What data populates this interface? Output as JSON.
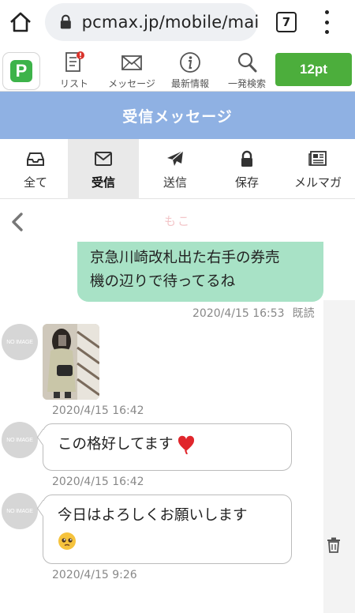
{
  "browser": {
    "url": "pcmax.jp/mobile/mail_",
    "tab_count": "7"
  },
  "site_nav": {
    "logo_letter": "P",
    "items": [
      {
        "label": "リスト",
        "icon": "list-icon"
      },
      {
        "label": "メッセージ",
        "icon": "envelope-icon"
      },
      {
        "label": "最新情報",
        "icon": "info-icon"
      },
      {
        "label": "一発検索",
        "icon": "search-icon"
      }
    ],
    "points": "12pt",
    "colors": {
      "points_button": "#4cae3c",
      "notification_badge": "#d9332b"
    }
  },
  "title_bar": {
    "title": "受信メッセージ",
    "color": "#8fb1e3"
  },
  "folder_tabs": [
    {
      "label": "全て",
      "icon": "inbox-tray-icon",
      "active": false
    },
    {
      "label": "受信",
      "icon": "envelope-icon",
      "active": true
    },
    {
      "label": "送信",
      "icon": "paper-plane-icon",
      "active": false
    },
    {
      "label": "保存",
      "icon": "lock-icon",
      "active": false
    },
    {
      "label": "メルマガ",
      "icon": "newspaper-icon",
      "active": false
    }
  ],
  "conversation": {
    "partner_name": "もこ",
    "messages": [
      {
        "direction": "sent",
        "text_line1": "京急川崎改札出た右手の券売",
        "text_line2": "機の辺りで待ってるね",
        "timestamp": "2020/4/15 16:53",
        "status": "既読",
        "color": "#a8e2c6"
      },
      {
        "direction": "received",
        "type": "photo",
        "avatar_text": "NO IMAGE",
        "timestamp": "2020/4/15 16:42"
      },
      {
        "direction": "received",
        "text": "この格好してます",
        "emoji": "red-heart-emoji",
        "avatar_text": "NO IMAGE",
        "timestamp": "2020/4/15 16:42"
      },
      {
        "direction": "received",
        "text": "今日はよろしくお願いします",
        "emoji": "pleading-face-emoji",
        "avatar_text": "NO IMAGE",
        "timestamp": "2020/4/15 9:26"
      }
    ]
  }
}
